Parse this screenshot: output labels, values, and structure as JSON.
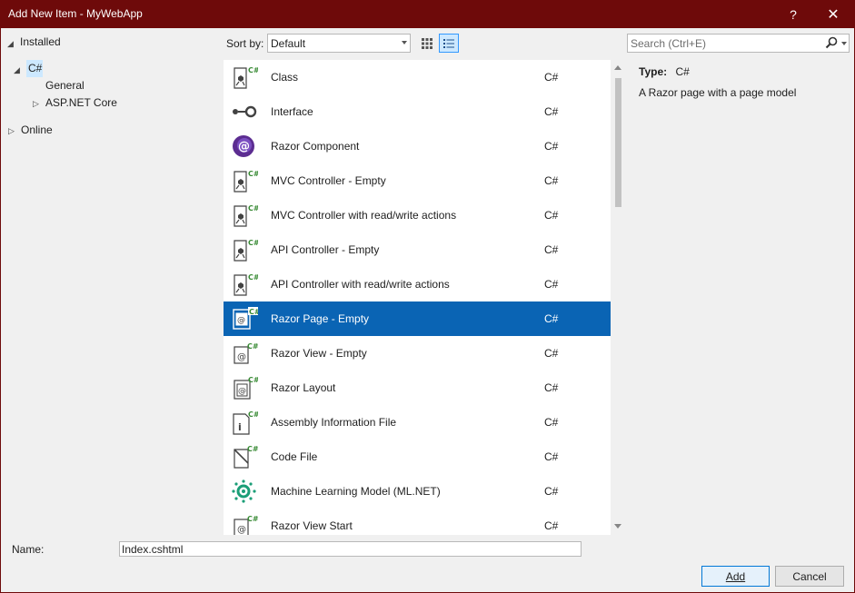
{
  "window": {
    "title": "Add New Item - MyWebApp",
    "help_glyph": "?",
    "close_glyph": "✕",
    "accent_color": "#6e0a0a"
  },
  "tree": {
    "installed": "Installed",
    "csharp": "C#",
    "general": "General",
    "aspnet": "ASP.NET Core",
    "online": "Online"
  },
  "toolbar": {
    "sort_label": "Sort by:",
    "sort_value": "Default",
    "search_placeholder": "Search (Ctrl+E)",
    "selected_view": "list"
  },
  "templates": [
    {
      "name": "Class",
      "lang": "C#",
      "icon": "class-icon"
    },
    {
      "name": "Interface",
      "lang": "C#",
      "icon": "interface-icon"
    },
    {
      "name": "Razor Component",
      "lang": "C#",
      "icon": "razor-component-icon"
    },
    {
      "name": "MVC Controller - Empty",
      "lang": "C#",
      "icon": "controller-icon"
    },
    {
      "name": "MVC Controller with read/write actions",
      "lang": "C#",
      "icon": "controller-icon"
    },
    {
      "name": "API Controller - Empty",
      "lang": "C#",
      "icon": "controller-icon"
    },
    {
      "name": "API Controller with read/write actions",
      "lang": "C#",
      "icon": "controller-icon"
    },
    {
      "name": "Razor Page - Empty",
      "lang": "C#",
      "icon": "razor-page-icon",
      "selected": true
    },
    {
      "name": "Razor View - Empty",
      "lang": "C#",
      "icon": "razor-view-icon"
    },
    {
      "name": "Razor Layout",
      "lang": "C#",
      "icon": "razor-layout-icon"
    },
    {
      "name": "Assembly Information File",
      "lang": "C#",
      "icon": "assembly-info-icon"
    },
    {
      "name": "Code File",
      "lang": "C#",
      "icon": "code-file-icon"
    },
    {
      "name": "Machine Learning Model (ML.NET)",
      "lang": "C#",
      "icon": "ml-model-icon"
    },
    {
      "name": "Razor View Start",
      "lang": "C#",
      "icon": "razor-view-icon"
    }
  ],
  "details": {
    "type_label": "Type:",
    "type_value": "C#",
    "description": "A Razor page with a page model"
  },
  "footer": {
    "name_label": "Name:",
    "name_value": "Index.cshtml",
    "add_label": "Add",
    "cancel_label": "Cancel"
  }
}
